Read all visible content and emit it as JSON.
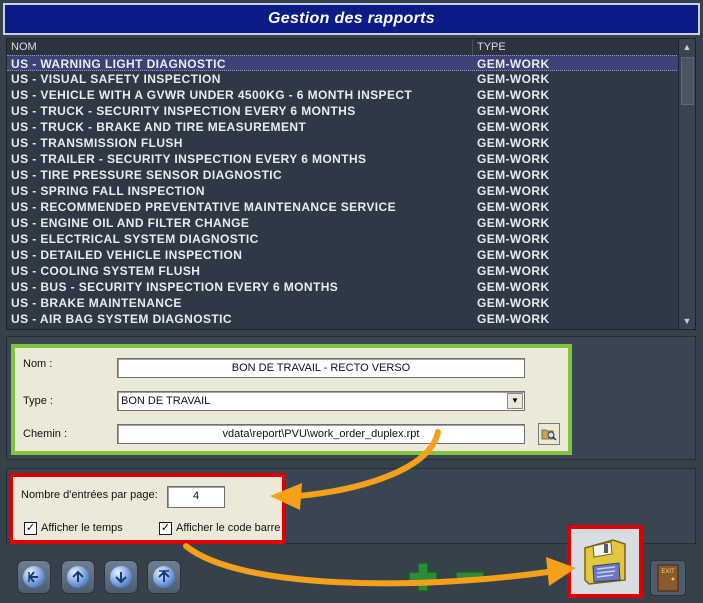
{
  "window": {
    "title": "Gestion des rapports"
  },
  "report_list": {
    "columns": [
      "NOM",
      "TYPE"
    ],
    "selected_index": 0,
    "rows": [
      {
        "name": "US - WARNING LIGHT DIAGNOSTIC",
        "type": "GEM-WORK"
      },
      {
        "name": "US - VISUAL SAFETY INSPECTION",
        "type": "GEM-WORK"
      },
      {
        "name": "US - VEHICLE WITH A GVWR UNDER 4500KG - 6 MONTH INSPECT",
        "type": "GEM-WORK"
      },
      {
        "name": "US - TRUCK - SECURITY INSPECTION EVERY 6 MONTHS",
        "type": "GEM-WORK"
      },
      {
        "name": "US - TRUCK - BRAKE AND TIRE MEASUREMENT",
        "type": "GEM-WORK"
      },
      {
        "name": "US - TRANSMISSION FLUSH",
        "type": "GEM-WORK"
      },
      {
        "name": "US - TRAILER - SECURITY INSPECTION EVERY 6 MONTHS",
        "type": "GEM-WORK"
      },
      {
        "name": "US - TIRE PRESSURE SENSOR DIAGNOSTIC",
        "type": "GEM-WORK"
      },
      {
        "name": "US - SPRING FALL INSPECTION",
        "type": "GEM-WORK"
      },
      {
        "name": "US - RECOMMENDED PREVENTATIVE MAINTENANCE SERVICE",
        "type": "GEM-WORK"
      },
      {
        "name": "US - ENGINE OIL AND FILTER CHANGE",
        "type": "GEM-WORK"
      },
      {
        "name": "US - ELECTRICAL SYSTEM DIAGNOSTIC",
        "type": "GEM-WORK"
      },
      {
        "name": "US - DETAILED VEHICLE INSPECTION",
        "type": "GEM-WORK"
      },
      {
        "name": "US - COOLING SYSTEM FLUSH",
        "type": "GEM-WORK"
      },
      {
        "name": "US - BUS - SECURITY INSPECTION EVERY 6 MONTHS",
        "type": "GEM-WORK"
      },
      {
        "name": "US - BRAKE MAINTENANCE",
        "type": "GEM-WORK"
      },
      {
        "name": "US - AIR BAG SYSTEM DIAGNOSTIC",
        "type": "GEM-WORK"
      }
    ]
  },
  "form": {
    "name_label": "Nom :",
    "name_value": "BON DE TRAVAIL - RECTO VERSO",
    "type_label": "Type :",
    "type_value": "BON DE TRAVAIL",
    "path_label": "Chemin :",
    "path_value": "vdata\\report\\PVU\\work_order_duplex.rpt"
  },
  "options": {
    "entries_label": "Nombre d'entrées par page:",
    "entries_value": "4",
    "show_time_label": "Afficher le temps",
    "show_time_checked": true,
    "show_barcode_label": "Afficher le code barre",
    "show_barcode_checked": true
  },
  "icons": {
    "nav": [
      "first-page-icon",
      "previous-page-icon",
      "next-page-icon",
      "last-page-icon"
    ],
    "add": "add-icon",
    "remove": "remove-icon",
    "save": "floppy-disk-icon",
    "exit": "exit-icon",
    "exit_text": "EXIT"
  },
  "colors": {
    "title_bar": "#0a1a86",
    "highlight_green": "#80c341",
    "highlight_red": "#e00000",
    "arrow_orange": "#f5a01a"
  }
}
